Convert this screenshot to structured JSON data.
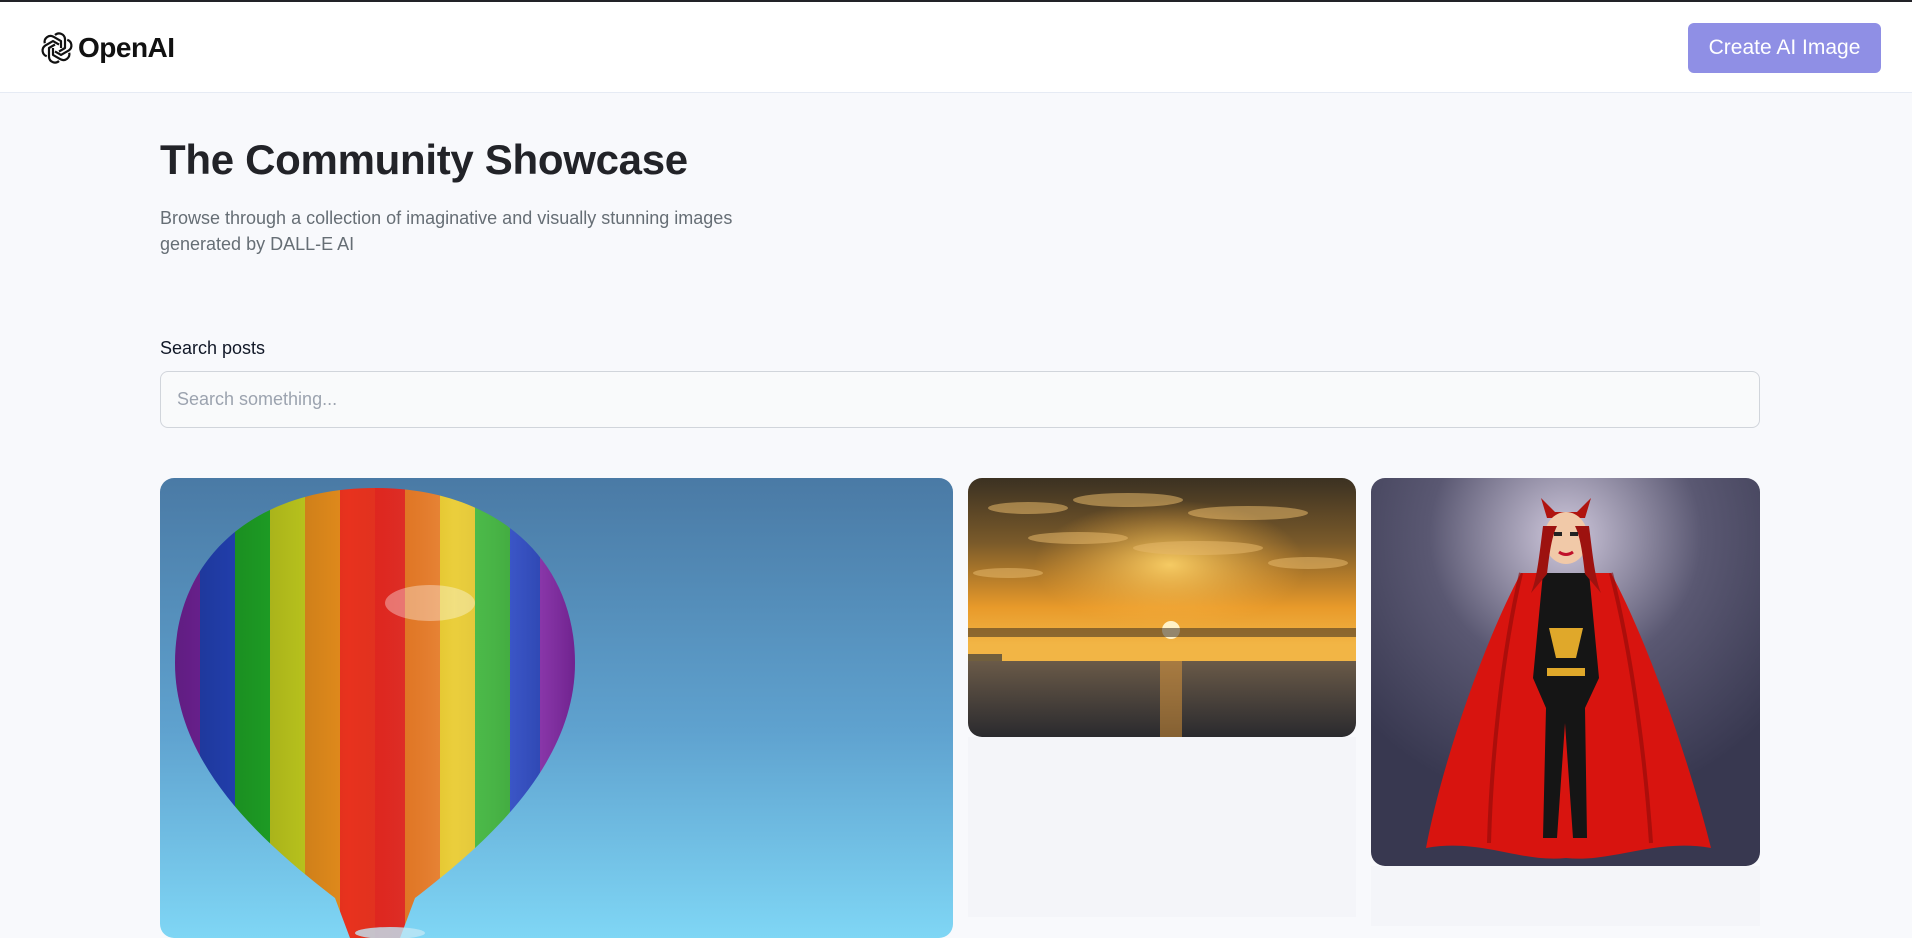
{
  "header": {
    "brand": "OpenAI",
    "logo_icon": "openai-logo-icon",
    "create_button_label": "Create AI Image",
    "accent_color": "#8f8fe5"
  },
  "hero": {
    "title": "The Community Showcase",
    "subtitle": "Browse through a collection of imaginative and visually stunning images generated by DALL-E AI"
  },
  "search": {
    "label": "Search posts",
    "placeholder": "Search something...",
    "value": ""
  },
  "gallery": {
    "cards": [
      {
        "image": "rainbow-hot-air-balloon"
      },
      {
        "image": "sunset-over-sea"
      },
      {
        "image": "cartoon-red-caped-heroine"
      }
    ]
  }
}
